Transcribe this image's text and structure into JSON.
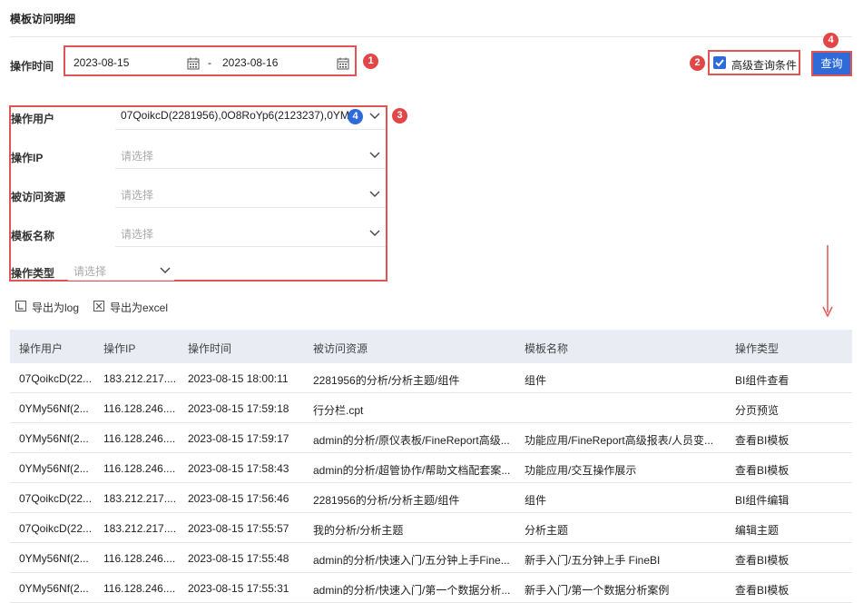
{
  "page": {
    "title": "模板访问明细"
  },
  "time_filter": {
    "label": "操作时间",
    "start": "2023-08-15",
    "separator": "-",
    "end": "2023-08-16"
  },
  "advanced": {
    "label": "高级查询条件",
    "checked": true
  },
  "query_button": "查询",
  "markers": {
    "m1": "1",
    "m2": "2",
    "m3": "3",
    "m4": "4"
  },
  "filters": {
    "user": {
      "label": "操作用户",
      "value": "07QoikcD(2281956),0O8RoYp6(2123237),0YM"
    },
    "ip": {
      "label": "操作IP",
      "placeholder": "请选择"
    },
    "resource": {
      "label": "被访问资源",
      "placeholder": "请选择"
    },
    "template": {
      "label": "模板名称",
      "placeholder": "请选择"
    },
    "type": {
      "label": "操作类型",
      "placeholder": "请选择"
    }
  },
  "toolbar": {
    "export_log": "导出为log",
    "export_excel": "导出为excel"
  },
  "table": {
    "headers": [
      "操作用户",
      "操作IP",
      "操作时间",
      "被访问资源",
      "模板名称",
      "操作类型"
    ],
    "rows": [
      [
        "07QoikcD(22...",
        "183.212.217....",
        "2023-08-15 18:00:11",
        "2281956的分析/分析主题/组件",
        "组件",
        "BI组件查看"
      ],
      [
        "0YMy56Nf(2...",
        "116.128.246....",
        "2023-08-15 17:59:18",
        "行分栏.cpt",
        "",
        "分页预览"
      ],
      [
        "0YMy56Nf(2...",
        "116.128.246....",
        "2023-08-15 17:59:17",
        "admin的分析/原仪表板/FineReport高级...",
        "功能应用/FineReport高级报表/人员变...",
        "查看BI模板"
      ],
      [
        "0YMy56Nf(2...",
        "116.128.246....",
        "2023-08-15 17:58:43",
        "admin的分析/超管协作/帮助文档配套案...",
        "功能应用/交互操作展示",
        "查看BI模板"
      ],
      [
        "07QoikcD(22...",
        "183.212.217....",
        "2023-08-15 17:56:46",
        "2281956的分析/分析主题/组件",
        "组件",
        "BI组件编辑"
      ],
      [
        "07QoikcD(22...",
        "183.212.217....",
        "2023-08-15 17:55:57",
        "我的分析/分析主题",
        "分析主题",
        "编辑主题"
      ],
      [
        "0YMy56Nf(2...",
        "116.128.246....",
        "2023-08-15 17:55:48",
        "admin的分析/快速入门/五分钟上手Fine...",
        "新手入门/五分钟上手 FineBI",
        "查看BI模板"
      ],
      [
        "0YMy56Nf(2...",
        "116.128.246....",
        "2023-08-15 17:55:31",
        "admin的分析/快速入门/第一个数据分析...",
        "新手入门/第一个数据分析案例",
        "查看BI模板"
      ]
    ]
  },
  "colors": {
    "accent": "#2f6bd8",
    "annotation": "#e05454",
    "header_bg": "#e9edf3"
  }
}
